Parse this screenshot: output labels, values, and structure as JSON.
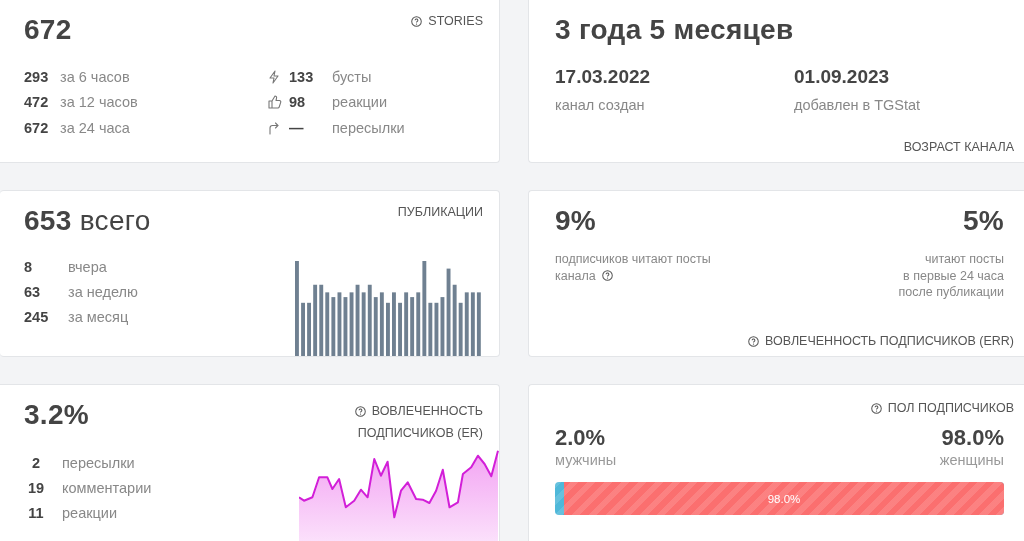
{
  "stories": {
    "value": "672",
    "title": "STORIES",
    "help": true,
    "periods": [
      {
        "value": "293",
        "label": "за 6 часов"
      },
      {
        "value": "472",
        "label": "за 12 часов"
      },
      {
        "value": "672",
        "label": "за 24 часа"
      }
    ],
    "stats": [
      {
        "kind": "boosts",
        "value": "133",
        "label": "бусты"
      },
      {
        "kind": "reactions",
        "value": "98",
        "label": "реакции"
      },
      {
        "kind": "forwards",
        "value": "—",
        "label": "пересылки"
      }
    ]
  },
  "age": {
    "title": "3 года 5 месяцев",
    "dates": [
      {
        "value": "17.03.2022",
        "label": "канал создан"
      },
      {
        "value": "01.09.2023",
        "label": "добавлен в TGStat"
      }
    ],
    "caption": "ВОЗРАСТ КАНАЛА"
  },
  "publications": {
    "value": "653",
    "unit": "всего",
    "title": "ПУБЛИКАЦИИ",
    "periods": [
      {
        "value": "8",
        "label": "вчера"
      },
      {
        "value": "63",
        "label": "за неделю"
      },
      {
        "value": "245",
        "label": "за месяц"
      }
    ]
  },
  "err": {
    "items": [
      {
        "value": "9%",
        "lines": [
          "подписчиков читают посты",
          "канала"
        ],
        "help": true
      },
      {
        "value": "5%",
        "lines": [
          "читают посты",
          "в первые 24 часа",
          "после публикации"
        ]
      }
    ],
    "caption": "ВОВЛЕЧЕННОСТЬ ПОДПИСЧИКОВ (ERR)",
    "help": true
  },
  "er": {
    "value": "3.2%",
    "title_lines": [
      "ВОВЛЕЧЕННОСТЬ",
      "ПОДПИСЧИКОВ (ER)"
    ],
    "help": true,
    "items": [
      {
        "value": "2",
        "label": "пересылки"
      },
      {
        "value": "19",
        "label": "комментарии"
      },
      {
        "value": "11",
        "label": "реакции"
      }
    ]
  },
  "gender": {
    "title": "ПОЛ ПОДПИСЧИКОВ",
    "help": true,
    "items": [
      {
        "value": "2.0%",
        "label": "мужчины",
        "color": "#4fb8d9"
      },
      {
        "value": "98.0%",
        "label": "женщины",
        "color": "#fb6f6f"
      }
    ],
    "bar": {
      "level": 0.98,
      "label": "98.0%"
    }
  }
}
